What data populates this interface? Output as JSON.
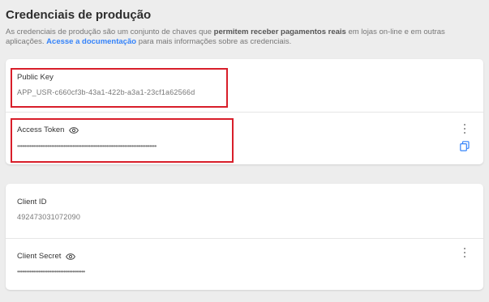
{
  "header": {
    "title": "Credenciais de produção",
    "desc_pre": "As credenciais de produção são um conjunto de chaves que ",
    "desc_bold": "permitem receber pagamentos reais",
    "desc_mid": " em lojas on-line e em outras aplicações. ",
    "desc_link": "Acesse a documentação",
    "desc_post": " para mais informações sobre as credenciais."
  },
  "production": {
    "public_key": {
      "label": "Public Key",
      "value": "APP_USR-c660cf3b-43a1-422b-a3a1-23cf1a62566d"
    },
    "access_token": {
      "label": "Access Token",
      "masked": "••••••••••••••••••••••••••••••••••••••••••••••••••••••••••••••••••••••••••••••"
    }
  },
  "client": {
    "client_id": {
      "label": "Client ID",
      "value": "492473031072090"
    },
    "client_secret": {
      "label": "Client Secret",
      "masked": "••••••••••••••••••••••••••••••••••••••"
    }
  },
  "icons": {
    "eye": "eye-icon",
    "kebab": "more-vertical-icon",
    "copy": "copy-icon"
  },
  "colors": {
    "link": "#3483fa",
    "highlight": "#d81e2a",
    "background": "#ededed"
  }
}
